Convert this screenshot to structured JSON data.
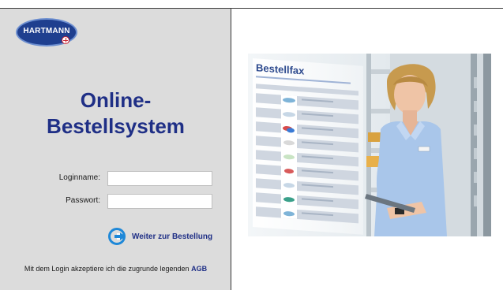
{
  "brand": {
    "logo_text": "HARTMANN",
    "color_primary": "#1f2f86"
  },
  "title": {
    "line1": "Online-",
    "line2": "Bestellsystem"
  },
  "form": {
    "login_label": "Loginname:",
    "login_value": "",
    "password_label": "Passwort:",
    "password_value": "",
    "submit_label": "Weiter zur Bestellung"
  },
  "footer": {
    "agb_prefix": "Mit dem Login akzeptiere ich die zugrunde legenden",
    "agb_link": "AGB"
  },
  "photo": {
    "sheet_title": "Bestellfax"
  }
}
